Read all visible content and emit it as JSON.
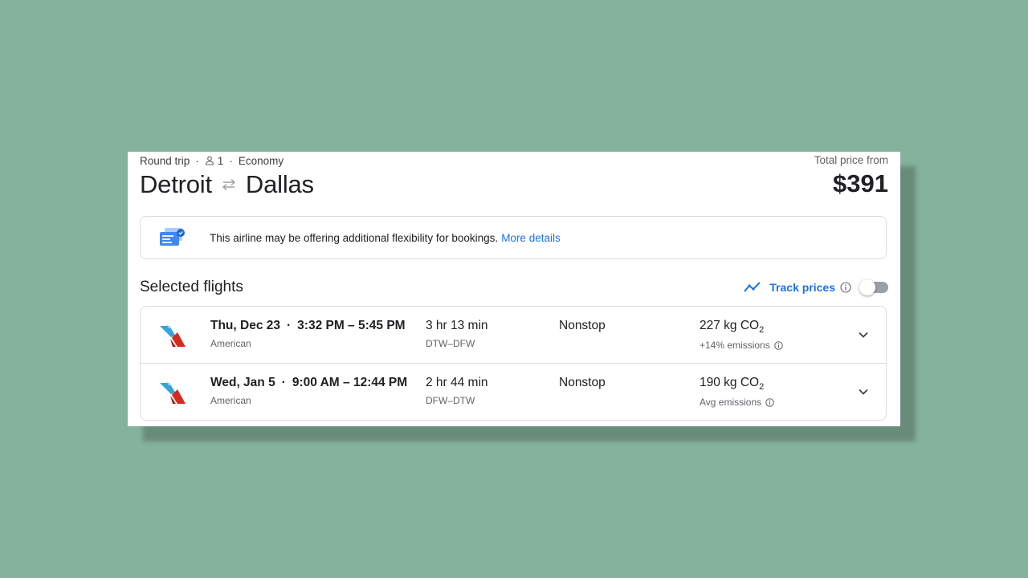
{
  "trip": {
    "type": "Round trip",
    "passengers": "1",
    "cabin": "Economy",
    "origin": "Detroit",
    "destination": "Dallas"
  },
  "price": {
    "label": "Total price from",
    "amount": "$391"
  },
  "banner": {
    "text": "This airline may be offering additional flexibility for bookings.",
    "link": "More details"
  },
  "section": {
    "title": "Selected flights",
    "track_label": "Track prices",
    "track_enabled": false
  },
  "flights": [
    {
      "date": "Thu, Dec 23",
      "times": "3:32 PM – 5:45 PM",
      "airline": "American",
      "duration": "3 hr 13 min",
      "route": "DTW–DFW",
      "stops": "Nonstop",
      "co2_value": "227 kg CO",
      "co2_sub": "2",
      "emissions_note": "+14% emissions"
    },
    {
      "date": "Wed, Jan 5",
      "times": "9:00 AM – 12:44 PM",
      "airline": "American",
      "duration": "2 hr 44 min",
      "route": "DFW–DTW",
      "stops": "Nonstop",
      "co2_value": "190 kg CO",
      "co2_sub": "2",
      "emissions_note": "Avg emissions"
    }
  ],
  "colors": {
    "background": "#84b29c",
    "accent": "#1a73e8",
    "airline_blue": "#36a3d9",
    "airline_red": "#d52b1e"
  },
  "icons": {
    "passenger": "person-icon",
    "route_swap": "swap-arrows-icon",
    "banner": "ticket-flex-icon",
    "track": "trend-line-icon",
    "info": "info-icon",
    "expand": "chevron-down-icon",
    "airline": "american-airlines-logo"
  }
}
